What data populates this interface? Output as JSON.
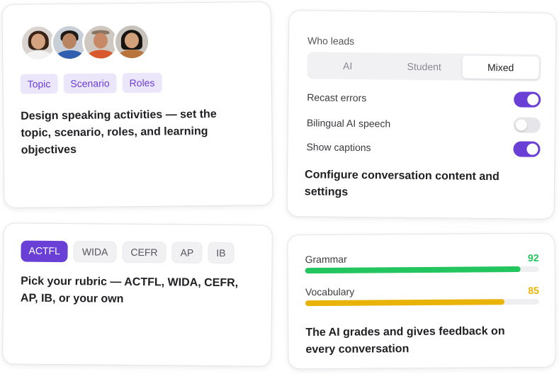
{
  "design_card": {
    "chips": [
      "Topic",
      "Scenario",
      "Roles"
    ],
    "heading": "Design speaking activities — set the topic, scenario, roles, and learning objectives"
  },
  "settings_card": {
    "who_leads_label": "Who leads",
    "segments": [
      "AI",
      "Student",
      "Mixed"
    ],
    "selected_segment": "Mixed",
    "toggles": [
      {
        "label": "Recast errors",
        "on": true
      },
      {
        "label": "Bilingual AI speech",
        "on": false
      },
      {
        "label": "Show captions",
        "on": true
      }
    ],
    "heading": "Configure conversation content and settings"
  },
  "rubric_card": {
    "options": [
      "ACTFL",
      "WIDA",
      "CEFR",
      "AP",
      "IB"
    ],
    "selected": "ACTFL",
    "heading": "Pick your rubric — ACTFL, WIDA, CEFR, AP, IB, or your own"
  },
  "grades_card": {
    "metrics": [
      {
        "label": "Grammar",
        "score": "92",
        "fraction": 0.92,
        "color": "#22c55e"
      },
      {
        "label": "Vocabulary",
        "score": "85",
        "fraction": 0.85,
        "color": "#eab308"
      }
    ],
    "heading": "The AI grades and gives feedback on every conversation"
  },
  "colors": {
    "accent": "#6a3fd6",
    "chip_bg": "#ece6fb",
    "toggle_off": "#e6e6ea"
  }
}
